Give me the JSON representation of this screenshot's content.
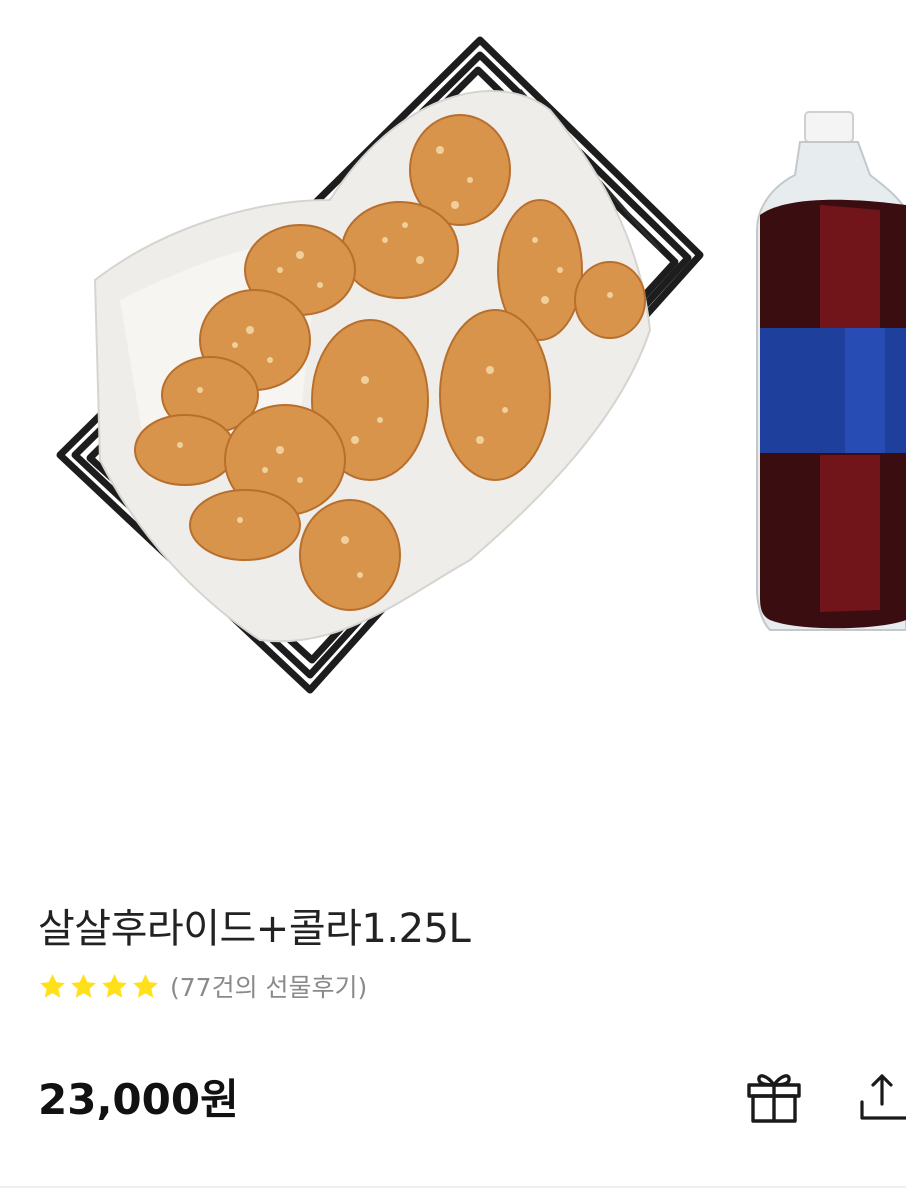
{
  "product": {
    "title": "살살후라이드+콜라1.25L",
    "rating_stars": 4,
    "review_count_text": "(77건의 선물후기)",
    "price": "23,000원"
  },
  "actions": {
    "gift_icon": "gift-icon",
    "share_icon": "share-icon"
  },
  "colors": {
    "star": "#ffe01b",
    "title_text": "#222222",
    "subtext": "#8a8a8a",
    "price_text": "#111111"
  }
}
